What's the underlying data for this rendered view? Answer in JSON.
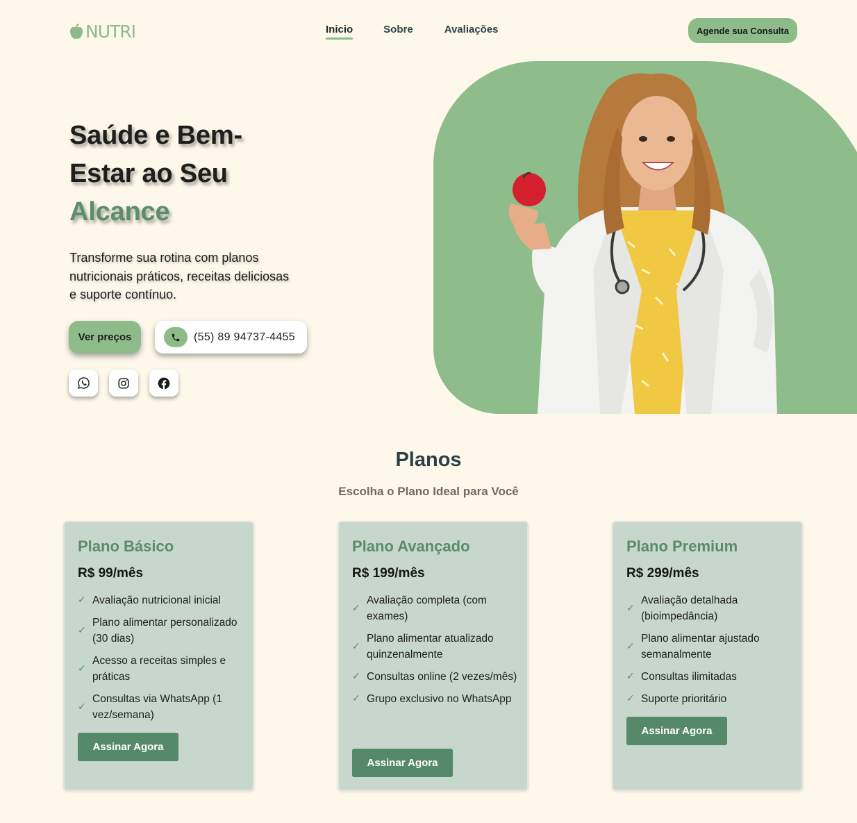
{
  "header": {
    "logo_text": "NUTRI",
    "nav": [
      {
        "label": "Inicio",
        "active": true
      },
      {
        "label": "Sobre",
        "active": false
      },
      {
        "label": "Avaliações",
        "active": false
      }
    ],
    "cta_label": "Agende sua Consulta"
  },
  "hero": {
    "title_line1": "Saúde e Bem-",
    "title_line2": "Estar ao Seu",
    "title_accent": "Alcance",
    "description": "Transforme sua rotina com planos nutricionais práticos, receitas deliciosas e suporte contínuo.",
    "prices_button": "Ver preços",
    "phone": "(55) 89 94737-4455",
    "phone_icon": "phone-icon",
    "socials": [
      {
        "name": "whatsapp-icon"
      },
      {
        "name": "instagram-icon"
      },
      {
        "name": "facebook-icon"
      }
    ]
  },
  "plans": {
    "title": "Planos",
    "subtitle": "Escolha o Plano Ideal para Você",
    "items": [
      {
        "name": "Plano Básico",
        "price": "R$ 99/mês",
        "features": [
          "Avaliação nutricional inicial",
          "Plano alimentar personalizado (30 dias)",
          "Acesso a receitas simples e práticas",
          "Consultas via WhatsApp (1 vez/semana)"
        ],
        "button": "Assinar Agora"
      },
      {
        "name": "Plano Avançado",
        "price": "R$ 199/mês",
        "features": [
          "Avaliação completa (com exames)",
          "Plano alimentar atualizado quinzenalmente",
          "Consultas online (2 vezes/mês)",
          "Grupo exclusivo no WhatsApp"
        ],
        "button": "Assinar Agora"
      },
      {
        "name": "Plano Premium",
        "price": "R$ 299/mês",
        "features": [
          "Avaliação detalhada (bioimpedância)",
          "Plano alimentar ajustado semanalmente",
          "Consultas ilimitadas",
          "Suporte prioritário"
        ],
        "button": "Assinar Agora"
      }
    ]
  },
  "colors": {
    "background": "#fdf8ea",
    "brand_green": "#8dbb8a",
    "dark_green": "#55896a",
    "card_bg": "#c7d7cd"
  }
}
